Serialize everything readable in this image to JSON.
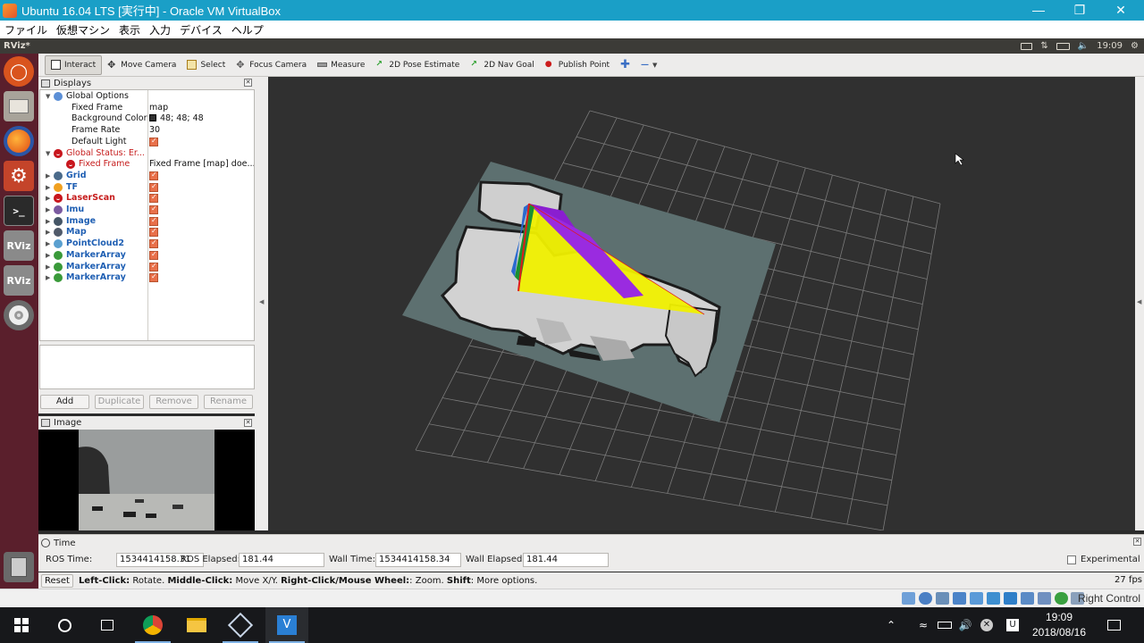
{
  "vbox": {
    "title": "Ubuntu  16.04 LTS [実行中] - Oracle VM VirtualBox",
    "menu": [
      "ファイル",
      "仮想マシン",
      "表示",
      "入力",
      "デバイス",
      "ヘルプ"
    ],
    "host_key": "Right Control"
  },
  "ubuntu_panel": {
    "app_title": "RViz*",
    "clock": "19:09"
  },
  "toolbar": [
    {
      "label": "Interact",
      "icon": "interact-icon",
      "active": true
    },
    {
      "label": "Move Camera",
      "icon": "move-camera-icon"
    },
    {
      "label": "Select",
      "icon": "select-icon"
    },
    {
      "label": "Focus Camera",
      "icon": "focus-camera-icon"
    },
    {
      "label": "Measure",
      "icon": "measure-icon"
    },
    {
      "label": "2D Pose Estimate",
      "icon": "pose-estimate-icon"
    },
    {
      "label": "2D Nav Goal",
      "icon": "nav-goal-icon"
    },
    {
      "label": "Publish Point",
      "icon": "publish-point-icon"
    }
  ],
  "displays": {
    "title": "Displays",
    "rows": [
      {
        "name": "Global Options",
        "icon": "globe-icon",
        "expanded": true,
        "indent": 0,
        "value": ""
      },
      {
        "name": "Fixed Frame",
        "indent": 1,
        "value": "map"
      },
      {
        "name": "Background Color",
        "indent": 1,
        "value": "48; 48; 48",
        "swatch": "#303030"
      },
      {
        "name": "Frame Rate",
        "indent": 1,
        "value": "30"
      },
      {
        "name": "Default Light",
        "indent": 1,
        "checkbox": true
      },
      {
        "name": "Global Status: Er...",
        "icon": "error-icon",
        "expanded": true,
        "indent": 0,
        "error": true
      },
      {
        "name": "Fixed Frame",
        "icon": "error-icon",
        "indent": 1,
        "value": "Fixed Frame [map] doe...",
        "error": true
      },
      {
        "name": "Grid",
        "icon": "grid-icon",
        "indent": 0,
        "checkbox": true,
        "display": true
      },
      {
        "name": "TF",
        "icon": "warning-icon",
        "indent": 0,
        "checkbox": true,
        "display": true
      },
      {
        "name": "LaserScan",
        "icon": "error-icon",
        "indent": 0,
        "checkbox": true,
        "display": true,
        "error": true
      },
      {
        "name": "Imu",
        "icon": "imu-icon",
        "indent": 0,
        "checkbox": true,
        "display": true
      },
      {
        "name": "Image",
        "icon": "image-icon",
        "indent": 0,
        "checkbox": true,
        "display": true
      },
      {
        "name": "Map",
        "icon": "map-icon",
        "indent": 0,
        "checkbox": true,
        "display": true
      },
      {
        "name": "PointCloud2",
        "icon": "pointcloud-icon",
        "indent": 0,
        "checkbox": true,
        "display": true
      },
      {
        "name": "MarkerArray",
        "icon": "marker-icon",
        "indent": 0,
        "checkbox": true,
        "display": true
      },
      {
        "name": "MarkerArray",
        "icon": "marker-icon",
        "indent": 0,
        "checkbox": true,
        "display": true
      },
      {
        "name": "MarkerArray",
        "icon": "marker-icon",
        "indent": 0,
        "checkbox": true,
        "display": true
      }
    ],
    "buttons": {
      "add": "Add",
      "duplicate": "Duplicate",
      "remove": "Remove",
      "rename": "Rename"
    }
  },
  "image_panel": {
    "title": "Image"
  },
  "time": {
    "title": "Time",
    "ros_time_label": "ROS Time:",
    "ros_time": "1534414158.31",
    "ros_elapsed_label": "ROS Elapsed:",
    "ros_elapsed": "181.44",
    "wall_time_label": "Wall Time:",
    "wall_time": "1534414158.34",
    "wall_elapsed_label": "Wall Elapsed:",
    "wall_elapsed": "181.44",
    "experimental_label": "Experimental"
  },
  "status": {
    "reset": "Reset",
    "hint_bold1": "Left-Click:",
    "hint1": " Rotate. ",
    "hint_bold2": "Middle-Click:",
    "hint2": " Move X/Y. ",
    "hint_bold3": "Right-Click/Mouse Wheel:",
    "hint3": ": Zoom. ",
    "hint_bold4": "Shift",
    "hint4": ": More options.",
    "fps": "27 fps"
  },
  "taskbar": {
    "time": "19:09",
    "date": "2018/08/16"
  },
  "colors": {
    "vbox_title": "#1a9fc7",
    "launcher": "#5a1f2c",
    "ubuntu_panel": "#3c3b37",
    "rviz_bg": "#303030",
    "map_plane": "#5d7070",
    "laser_purple": "#8a1ed0",
    "laser_yellow": "#f0f000"
  }
}
